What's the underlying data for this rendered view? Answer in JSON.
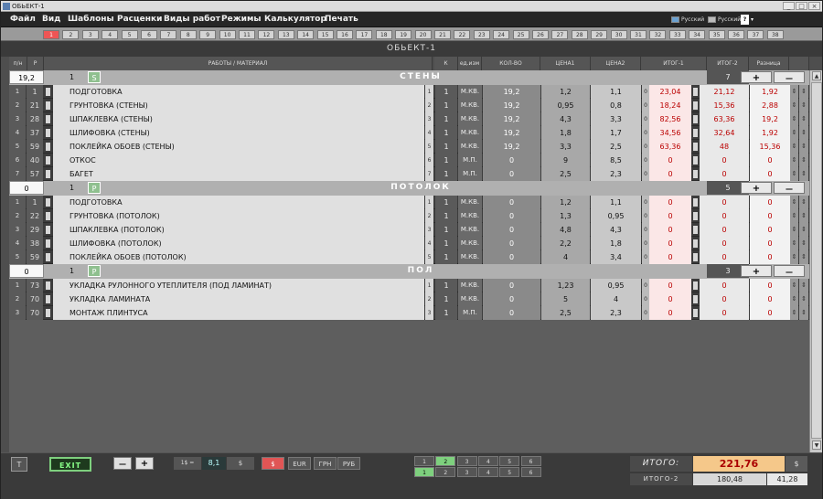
{
  "window": {
    "title": "ОБЬЕКТ-1"
  },
  "menu": [
    "Файл",
    "Вид",
    "Шаблоны",
    "Расценки",
    "Виды работ",
    "Режимы",
    "Калькулятор",
    "Печать"
  ],
  "lang": {
    "a": "Русский",
    "b": "Русский",
    "help": "?"
  },
  "tabs": [
    "1",
    "2",
    "3",
    "4",
    "5",
    "6",
    "7",
    "8",
    "9",
    "10",
    "11",
    "12",
    "13",
    "14",
    "15",
    "16",
    "17",
    "18",
    "19",
    "20",
    "21",
    "22",
    "23",
    "24",
    "25",
    "26",
    "27",
    "28",
    "29",
    "30",
    "31",
    "32",
    "33",
    "34",
    "35",
    "36",
    "37",
    "38"
  ],
  "active_tab": "1",
  "object_title": "ОБЬЕКТ-1",
  "headers": {
    "pn": "п/н",
    "p": "Р",
    "work": "РАБОТЫ / МАТЕРИАЛ",
    "k": "К",
    "unit": "ед.изм",
    "qty": "КОЛ-ВО",
    "price1": "ЦЕНА1",
    "price2": "ЦЕНА2",
    "total1": "ИТОГ-1",
    "total2": "ИТОГ-2",
    "diff": "Разница"
  },
  "sections": [
    {
      "value": "19,2",
      "num": "1",
      "badge": "S",
      "title": "СТЕНЫ",
      "count": "7",
      "plus": "+",
      "minus": "—",
      "rows": [
        {
          "n": "1",
          "code": "1",
          "name": "ПОДГОТОВКА",
          "idx": "1",
          "k": "1",
          "unit": "М.КВ.",
          "qty": "19,2",
          "p1": "1,2",
          "p2": "1,1",
          "t1": "23,04",
          "t2": "21,12",
          "d": "1,92"
        },
        {
          "n": "2",
          "code": "21",
          "name": "ГРУНТОВКА (СТЕНЫ)",
          "idx": "2",
          "k": "1",
          "unit": "М.КВ.",
          "qty": "19,2",
          "p1": "0,95",
          "p2": "0,8",
          "t1": "18,24",
          "t2": "15,36",
          "d": "2,88"
        },
        {
          "n": "3",
          "code": "28",
          "name": "ШПАКЛЕВКА (СТЕНЫ)",
          "idx": "3",
          "k": "1",
          "unit": "М.КВ.",
          "qty": "19,2",
          "p1": "4,3",
          "p2": "3,3",
          "t1": "82,56",
          "t2": "63,36",
          "d": "19,2"
        },
        {
          "n": "4",
          "code": "37",
          "name": "ШЛИФОВКА (СТЕНЫ)",
          "idx": "4",
          "k": "1",
          "unit": "М.КВ.",
          "qty": "19,2",
          "p1": "1,8",
          "p2": "1,7",
          "t1": "34,56",
          "t2": "32,64",
          "d": "1,92"
        },
        {
          "n": "5",
          "code": "59",
          "name": "ПОКЛЕЙКА ОБОЕВ (СТЕНЫ)",
          "idx": "5",
          "k": "1",
          "unit": "М.КВ.",
          "qty": "19,2",
          "p1": "3,3",
          "p2": "2,5",
          "t1": "63,36",
          "t2": "48",
          "d": "15,36"
        },
        {
          "n": "6",
          "code": "40",
          "name": "ОТКОС",
          "idx": "6",
          "k": "1",
          "unit": "М.П.",
          "qty": "0",
          "p1": "9",
          "p2": "8,5",
          "t1": "0",
          "t2": "0",
          "d": "0"
        },
        {
          "n": "7",
          "code": "57",
          "name": "БАГЕТ",
          "idx": "7",
          "k": "1",
          "unit": "М.П.",
          "qty": "0",
          "p1": "2,5",
          "p2": "2,3",
          "t1": "0",
          "t2": "0",
          "d": "0"
        }
      ]
    },
    {
      "value": "0",
      "num": "1",
      "badge": "P",
      "title": "ПОТОЛОК",
      "count": "5",
      "plus": "+",
      "minus": "—",
      "rows": [
        {
          "n": "1",
          "code": "1",
          "name": "ПОДГОТОВКА",
          "idx": "1",
          "k": "1",
          "unit": "М.КВ.",
          "qty": "0",
          "p1": "1,2",
          "p2": "1,1",
          "t1": "0",
          "t2": "0",
          "d": "0"
        },
        {
          "n": "2",
          "code": "22",
          "name": "ГРУНТОВКА (ПОТОЛОК)",
          "idx": "2",
          "k": "1",
          "unit": "М.КВ.",
          "qty": "0",
          "p1": "1,3",
          "p2": "0,95",
          "t1": "0",
          "t2": "0",
          "d": "0"
        },
        {
          "n": "3",
          "code": "29",
          "name": "ШПАКЛЕВКА (ПОТОЛОК)",
          "idx": "3",
          "k": "1",
          "unit": "М.КВ.",
          "qty": "0",
          "p1": "4,8",
          "p2": "4,3",
          "t1": "0",
          "t2": "0",
          "d": "0"
        },
        {
          "n": "4",
          "code": "38",
          "name": "ШЛИФОВКА (ПОТОЛОК)",
          "idx": "4",
          "k": "1",
          "unit": "М.КВ.",
          "qty": "0",
          "p1": "2,2",
          "p2": "1,8",
          "t1": "0",
          "t2": "0",
          "d": "0"
        },
        {
          "n": "5",
          "code": "59",
          "name": "ПОКЛЕЙКА ОБОЕВ (ПОТОЛОК)",
          "idx": "5",
          "k": "1",
          "unit": "М.КВ.",
          "qty": "0",
          "p1": "4",
          "p2": "3,4",
          "t1": "0",
          "t2": "0",
          "d": "0"
        }
      ]
    },
    {
      "value": "0",
      "num": "1",
      "badge": "P",
      "title": "ПОЛ",
      "count": "3",
      "plus": "+",
      "minus": "—",
      "rows": [
        {
          "n": "1",
          "code": "73",
          "name": "УКЛАДКА РУЛОННОГО УТЕПЛИТЕЛЯ (ПОД ЛАМИНАТ)",
          "idx": "1",
          "k": "1",
          "unit": "М.КВ.",
          "qty": "0",
          "p1": "1,23",
          "p2": "0,95",
          "t1": "0",
          "t2": "0",
          "d": "0"
        },
        {
          "n": "2",
          "code": "70",
          "name": "УКЛАДКА ЛАМИНАТА",
          "idx": "2",
          "k": "1",
          "unit": "М.КВ.",
          "qty": "0",
          "p1": "5",
          "p2": "4",
          "t1": "0",
          "t2": "0",
          "d": "0"
        },
        {
          "n": "3",
          "code": "70",
          "name": "МОНТАЖ ПЛИНТУСА",
          "idx": "3",
          "k": "1",
          "unit": "М.П.",
          "qty": "0",
          "p1": "2,5",
          "p2": "2,3",
          "t1": "0",
          "t2": "0",
          "d": "0"
        }
      ]
    }
  ],
  "bottom": {
    "t_button": "T",
    "exit": "EXIT",
    "minus": "—",
    "plus": "+",
    "rate_label": "1$ =",
    "rate_value": "8,1",
    "rate_currency": "$",
    "currencies": [
      "$",
      "EUR",
      "ГРН",
      "РУБ"
    ],
    "active_currency": "$",
    "pages_top": [
      "1",
      "2",
      "3",
      "4",
      "5",
      "6"
    ],
    "pages_bottom": [
      "1",
      "2",
      "3",
      "4",
      "5",
      "6"
    ],
    "active_page_top": "2",
    "active_page_bottom": "1",
    "total_label": "ИТОГО:",
    "total_value": "221,76",
    "total_currency": "$",
    "total2_label": "ИТОГО-2",
    "total2_value": "180,48",
    "total2_diff": "41,28"
  },
  "colors": {
    "accent_red": "#e05555",
    "green": "#7ed07e",
    "total_bg": "#f5c88a",
    "row_light": "#d8d8d8",
    "row_dark": "#5a5a5a",
    "total1_bg": "#fbe7e7"
  }
}
